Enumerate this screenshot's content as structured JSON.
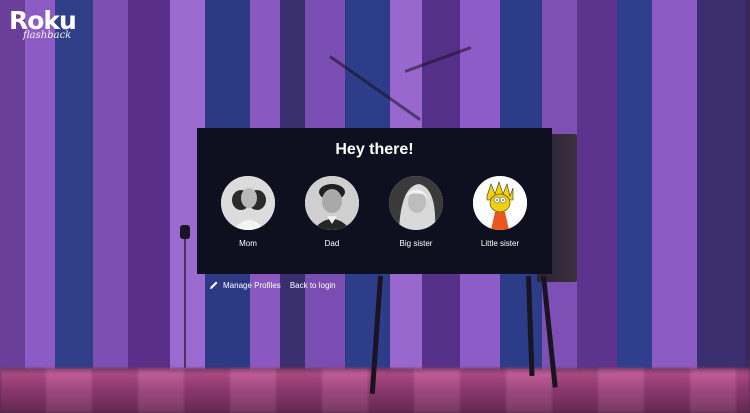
{
  "brand": {
    "name": "Roku",
    "tagline": "flashback"
  },
  "panel": {
    "title": "Hey there!"
  },
  "profiles": [
    {
      "name": "Mom",
      "avatar_icon": "mom-portrait"
    },
    {
      "name": "Dad",
      "avatar_icon": "dad-portrait"
    },
    {
      "name": "Big sister",
      "avatar_icon": "big-sister-portrait"
    },
    {
      "name": "Little sister",
      "avatar_icon": "lisa-simpson-cartoon"
    }
  ],
  "links": {
    "manage_profiles": "Manage Profiles",
    "back_to_login": "Back to login"
  },
  "colors": {
    "panel_bg": "#0e1020",
    "stripe_purple": "#8a5bc2",
    "stripe_blue": "#2e3f8c",
    "floor_pink": "#c85a9a"
  }
}
